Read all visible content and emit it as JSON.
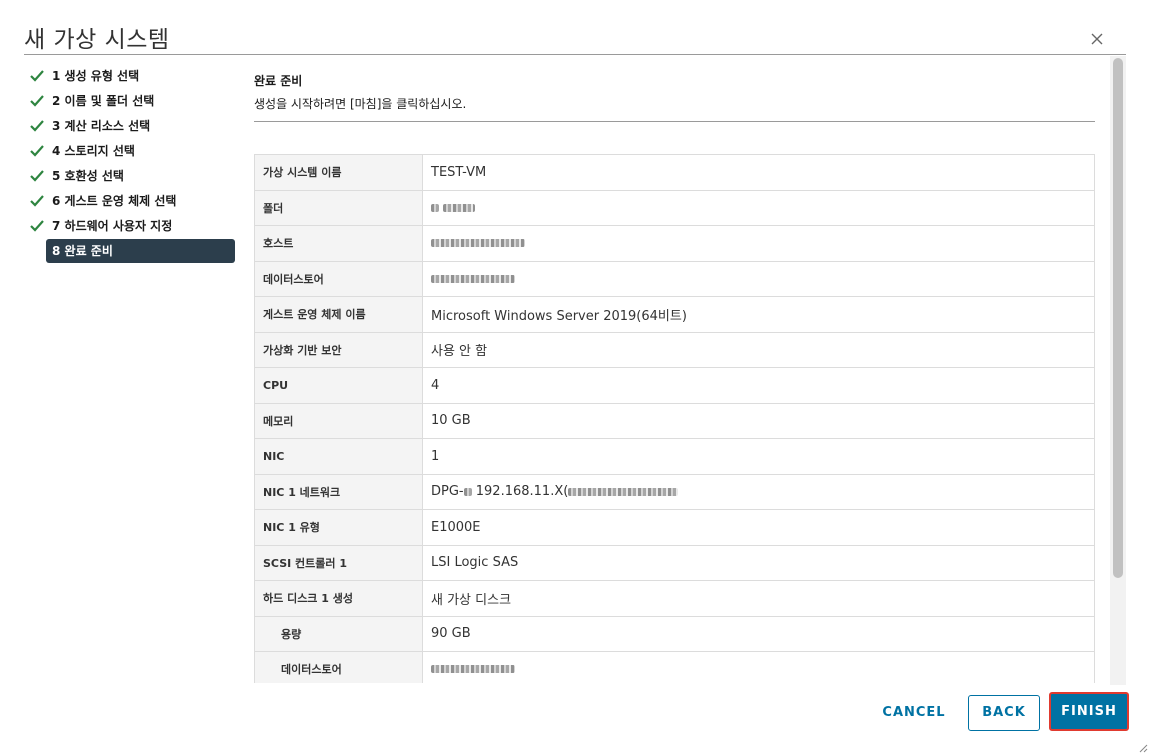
{
  "dialog": {
    "title": "새 가상 시스템"
  },
  "steps": [
    {
      "label": "1 생성 유형 선택",
      "done": true
    },
    {
      "label": "2 이름 및 폴더 선택",
      "done": true
    },
    {
      "label": "3 계산 리소스 선택",
      "done": true
    },
    {
      "label": "4 스토리지 선택",
      "done": true
    },
    {
      "label": "5 호환성 선택",
      "done": true
    },
    {
      "label": "6 게스트 운영 체제 선택",
      "done": true
    },
    {
      "label": "7 하드웨어 사용자 지정",
      "done": true
    },
    {
      "label": "8 완료 준비",
      "active": true
    }
  ],
  "section": {
    "title": "완료 준비",
    "subtitle": "생성을 시작하려면 [마침]을 클릭하십시오."
  },
  "summary": [
    {
      "key": "가상 시스템 이름",
      "value": "TEST-VM"
    },
    {
      "key": "폴더",
      "value": ""
    },
    {
      "key": "호스트",
      "value": ""
    },
    {
      "key": "데이터스토어",
      "value": ""
    },
    {
      "key": "게스트 운영 체제 이름",
      "value": "Microsoft Windows Server 2019(64비트)"
    },
    {
      "key": "가상화 기반 보안",
      "value": "사용 안 함"
    },
    {
      "key": "CPU",
      "value": "4"
    },
    {
      "key": "메모리",
      "value": "10 GB"
    },
    {
      "key": "NIC",
      "value": "1"
    },
    {
      "key": "NIC 1 네트워크",
      "value": "DPG-",
      "value_suffix": "192.168.11.X("
    },
    {
      "key": "NIC 1 유형",
      "value": "E1000E"
    },
    {
      "key": "SCSI 컨트롤러 1",
      "value": "LSI Logic SAS"
    },
    {
      "key": "하드 디스크 1 생성",
      "value": "새 가상 디스크"
    },
    {
      "key": "용량",
      "value": "90 GB",
      "indent": true
    },
    {
      "key": "데이터스토어",
      "value": "",
      "indent": true
    }
  ],
  "buttons": {
    "cancel": "CANCEL",
    "back": "BACK",
    "finish": "FINISH"
  },
  "colors": {
    "accent": "#0072a3",
    "check": "#2e8540",
    "active_step_bg": "#2c3e4c",
    "highlight_border": "#e03a2f"
  }
}
